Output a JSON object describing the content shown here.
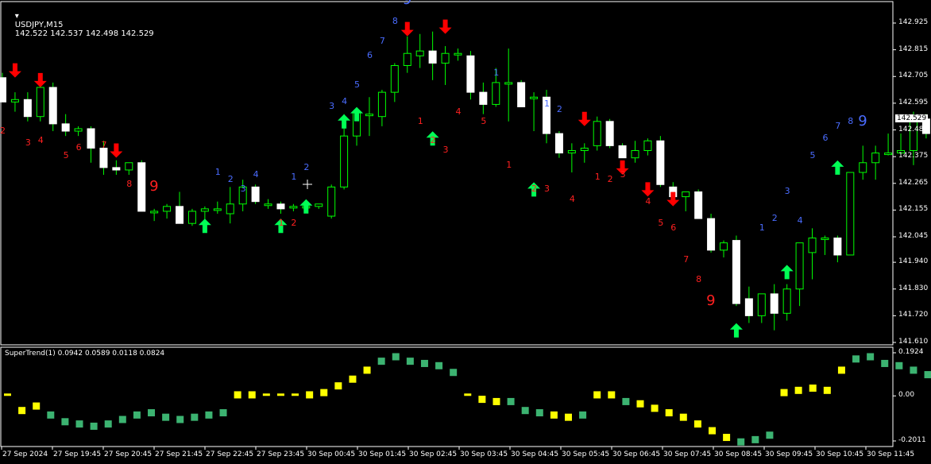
{
  "main": {
    "symbol_header": "USDJPY,M15",
    "ohlc": "142.522 142.537 142.498 142.529",
    "current_price": "142.529",
    "price_labels": [
      "142.925",
      "142.815",
      "142.705",
      "142.595",
      "142.485",
      "142.375",
      "142.265",
      "142.155",
      "142.045",
      "141.940",
      "141.830",
      "141.720",
      "141.610"
    ]
  },
  "indicator": {
    "header": "SuperTrend(1) 0.0942 0.0589 0.0118 0.0824",
    "scale_labels": [
      "0.1924",
      "0.00",
      "-0.2011"
    ]
  },
  "time_axis": [
    "27 Sep 2024",
    "27 Sep 19:45",
    "27 Sep 20:45",
    "27 Sep 21:45",
    "27 Sep 22:45",
    "27 Sep 23:45",
    "30 Sep 00:45",
    "30 Sep 01:45",
    "30 Sep 02:45",
    "30 Sep 03:45",
    "30 Sep 04:45",
    "30 Sep 05:45",
    "30 Sep 06:45",
    "30 Sep 07:45",
    "30 Sep 08:45",
    "30 Sep 09:45",
    "30 Sep 10:45",
    "30 Sep 11:45"
  ],
  "colors": {
    "bull": "#ffffff",
    "bear": "#ffffff",
    "wick": "#00ff00",
    "buy": "#00ff55",
    "sell": "#ff0000",
    "count_up": "#4a6cff",
    "count_down": "#ff2020",
    "hist_yellow": "#ffff00",
    "hist_green": "#3cb371",
    "grid": "#ffffff"
  },
  "candles": [
    [
      142.7,
      142.72,
      142.6,
      142.6
    ],
    [
      142.6,
      142.64,
      142.56,
      142.61
    ],
    [
      142.61,
      142.64,
      142.52,
      142.54
    ],
    [
      142.54,
      142.68,
      142.52,
      142.66
    ],
    [
      142.66,
      142.68,
      142.48,
      142.51
    ],
    [
      142.51,
      142.55,
      142.46,
      142.48
    ],
    [
      142.48,
      142.5,
      142.46,
      142.49
    ],
    [
      142.49,
      142.5,
      142.35,
      142.41
    ],
    [
      142.41,
      142.44,
      142.3,
      142.33
    ],
    [
      142.33,
      142.36,
      142.3,
      142.32
    ],
    [
      142.32,
      142.35,
      142.3,
      142.35
    ],
    [
      142.35,
      142.36,
      142.15,
      142.15
    ],
    [
      142.15,
      142.16,
      142.11,
      142.15
    ],
    [
      142.15,
      142.18,
      142.12,
      142.17
    ],
    [
      142.17,
      142.23,
      142.1,
      142.1
    ],
    [
      142.1,
      142.16,
      142.09,
      142.15
    ],
    [
      142.15,
      142.17,
      142.11,
      142.16
    ],
    [
      142.16,
      142.19,
      142.14,
      142.16
    ],
    [
      142.14,
      142.25,
      142.1,
      142.18
    ],
    [
      142.18,
      142.28,
      142.15,
      142.25
    ],
    [
      142.25,
      142.26,
      142.18,
      142.19
    ],
    [
      142.18,
      142.2,
      142.16,
      142.18
    ],
    [
      142.18,
      142.19,
      142.14,
      142.16
    ],
    [
      142.17,
      142.18,
      142.15,
      142.17
    ],
    [
      142.17,
      142.18,
      142.16,
      142.17
    ],
    [
      142.17,
      142.18,
      142.16,
      142.18
    ],
    [
      142.13,
      142.26,
      142.12,
      142.25
    ],
    [
      142.25,
      142.55,
      142.24,
      142.46
    ],
    [
      142.46,
      142.56,
      142.42,
      142.56
    ],
    [
      142.55,
      142.62,
      142.46,
      142.55
    ],
    [
      142.54,
      142.65,
      142.5,
      142.64
    ],
    [
      142.64,
      142.76,
      142.6,
      142.75
    ],
    [
      142.75,
      142.87,
      142.72,
      142.8
    ],
    [
      142.79,
      142.88,
      142.74,
      142.81
    ],
    [
      142.81,
      142.89,
      142.69,
      142.76
    ],
    [
      142.76,
      142.83,
      142.67,
      142.8
    ],
    [
      142.8,
      142.82,
      142.77,
      142.8
    ],
    [
      142.79,
      142.81,
      142.61,
      142.64
    ],
    [
      142.64,
      142.68,
      142.55,
      142.59
    ],
    [
      142.59,
      142.74,
      142.58,
      142.68
    ],
    [
      142.68,
      142.82,
      142.52,
      142.68
    ],
    [
      142.68,
      142.69,
      142.58,
      142.58
    ],
    [
      142.62,
      142.64,
      142.48,
      142.62
    ],
    [
      142.62,
      142.65,
      142.43,
      142.47
    ],
    [
      142.47,
      142.48,
      142.37,
      142.39
    ],
    [
      142.39,
      142.43,
      142.31,
      142.4
    ],
    [
      142.4,
      142.43,
      142.35,
      142.41
    ],
    [
      142.42,
      142.54,
      142.4,
      142.52
    ],
    [
      142.52,
      142.53,
      142.41,
      142.42
    ],
    [
      142.42,
      142.43,
      142.37,
      142.37
    ],
    [
      142.37,
      142.44,
      142.35,
      142.4
    ],
    [
      142.4,
      142.45,
      142.38,
      142.44
    ],
    [
      142.44,
      142.46,
      142.25,
      142.26
    ],
    [
      142.25,
      142.27,
      142.2,
      142.21
    ],
    [
      142.21,
      142.23,
      142.15,
      142.23
    ],
    [
      142.23,
      142.24,
      142.12,
      142.12
    ],
    [
      142.12,
      142.14,
      141.98,
      141.99
    ],
    [
      141.99,
      142.03,
      141.96,
      142.02
    ],
    [
      142.03,
      142.05,
      141.76,
      141.77
    ],
    [
      141.79,
      141.84,
      141.69,
      141.72
    ],
    [
      141.72,
      141.81,
      141.69,
      141.81
    ],
    [
      141.81,
      141.85,
      141.66,
      141.73
    ],
    [
      141.73,
      141.85,
      141.7,
      141.83
    ],
    [
      141.83,
      142.01,
      141.76,
      142.02
    ],
    [
      141.98,
      142.08,
      141.87,
      142.04
    ],
    [
      142.04,
      142.05,
      141.97,
      142.04
    ],
    [
      142.04,
      142.05,
      141.94,
      141.97
    ],
    [
      141.97,
      142.31,
      141.97,
      142.31
    ],
    [
      142.31,
      142.42,
      142.28,
      142.35
    ],
    [
      142.35,
      142.42,
      142.28,
      142.39
    ],
    [
      142.39,
      142.47,
      142.38,
      142.39
    ],
    [
      142.39,
      142.47,
      142.38,
      142.4
    ],
    [
      142.4,
      142.56,
      142.34,
      142.53
    ],
    [
      142.53,
      142.55,
      142.45,
      142.47
    ],
    [
      142.47,
      142.53,
      142.45,
      142.52
    ]
  ],
  "counts": [
    [
      "2",
      "down",
      0,
      142.48
    ],
    [
      "3",
      "down",
      2,
      142.43
    ],
    [
      "4",
      "down",
      3,
      142.44
    ],
    [
      "5",
      "down",
      5,
      142.38
    ],
    [
      "6",
      "down",
      6,
      142.41
    ],
    [
      "7",
      "down",
      8,
      142.42
    ],
    [
      "8",
      "down",
      10,
      142.26
    ],
    [
      "9",
      "down",
      12,
      142.25,
      true
    ],
    [
      "1",
      "up",
      17,
      142.31
    ],
    [
      "2",
      "up",
      18,
      142.28
    ],
    [
      "3",
      "up",
      19,
      142.24
    ],
    [
      "4",
      "up",
      20,
      142.3
    ],
    [
      "1",
      "down",
      22,
      142.1
    ],
    [
      "2",
      "down",
      23,
      142.1
    ],
    [
      "1",
      "up",
      23,
      142.29
    ],
    [
      "2",
      "up",
      24,
      142.33
    ],
    [
      "3",
      "up",
      26,
      142.58
    ],
    [
      "4",
      "up",
      27,
      142.6
    ],
    [
      "5",
      "up",
      28,
      142.67
    ],
    [
      "6",
      "up",
      29,
      142.79
    ],
    [
      "7",
      "up",
      30,
      142.85
    ],
    [
      "8",
      "up",
      31,
      142.93
    ],
    [
      "9",
      "up",
      32,
      143.02,
      true
    ],
    [
      "1",
      "down",
      33,
      142.52
    ],
    [
      "2",
      "down",
      34,
      142.44
    ],
    [
      "3",
      "down",
      35,
      142.4
    ],
    [
      "4",
      "down",
      36,
      142.56
    ],
    [
      "5",
      "down",
      38,
      142.52
    ],
    [
      "1",
      "up",
      39,
      142.72
    ],
    [
      "1",
      "down",
      40,
      142.34
    ],
    [
      "1",
      "up",
      43,
      142.59
    ],
    [
      "2",
      "up",
      44,
      142.57
    ],
    [
      "2",
      "down",
      42,
      142.24
    ],
    [
      "3",
      "down",
      43,
      142.24
    ],
    [
      "4",
      "down",
      45,
      142.2
    ],
    [
      "1",
      "down",
      47,
      142.29
    ],
    [
      "2",
      "down",
      48,
      142.28
    ],
    [
      "3",
      "down",
      49,
      142.3
    ],
    [
      "4",
      "down",
      51,
      142.19
    ],
    [
      "5",
      "down",
      52,
      142.1
    ],
    [
      "6",
      "down",
      53,
      142.08
    ],
    [
      "7",
      "down",
      54,
      141.95
    ],
    [
      "8",
      "down",
      55,
      141.87
    ],
    [
      "9",
      "down",
      56,
      141.78,
      true
    ],
    [
      "1",
      "up",
      60,
      142.08
    ],
    [
      "2",
      "up",
      61,
      142.12
    ],
    [
      "3",
      "up",
      62,
      142.23
    ],
    [
      "4",
      "up",
      63,
      142.11
    ],
    [
      "5",
      "up",
      64,
      142.38
    ],
    [
      "6",
      "up",
      65,
      142.45
    ],
    [
      "7",
      "up",
      66,
      142.5
    ],
    [
      "8",
      "up",
      67,
      142.52
    ],
    [
      "9",
      "up",
      68,
      142.52,
      true
    ]
  ],
  "arrows": [
    [
      "sell",
      1,
      142.73
    ],
    [
      "sell",
      3,
      142.69
    ],
    [
      "sell",
      9,
      142.4
    ],
    [
      "buy",
      16,
      142.09
    ],
    [
      "buy",
      22,
      142.09
    ],
    [
      "buy",
      24,
      142.17
    ],
    [
      "buy",
      27,
      142.52
    ],
    [
      "buy",
      28,
      142.55
    ],
    [
      "sell",
      32,
      142.9
    ],
    [
      "sell",
      35,
      142.91
    ],
    [
      "buy",
      34,
      142.45
    ],
    [
      "buy",
      42,
      142.24
    ],
    [
      "sell",
      46,
      142.53
    ],
    [
      "sell",
      49,
      142.33
    ],
    [
      "sell",
      51,
      142.24
    ],
    [
      "sell",
      53,
      142.2
    ],
    [
      "buy",
      58,
      141.66
    ],
    [
      "buy",
      62,
      141.9
    ],
    [
      "buy",
      66,
      142.33
    ]
  ],
  "histogram": [
    [
      0.0,
      "y"
    ],
    [
      -0.06,
      "y"
    ],
    [
      -0.04,
      "y"
    ],
    [
      -0.08,
      "g"
    ],
    [
      -0.11,
      "g"
    ],
    [
      -0.12,
      "g"
    ],
    [
      -0.13,
      "g"
    ],
    [
      -0.12,
      "g"
    ],
    [
      -0.1,
      "g"
    ],
    [
      -0.08,
      "g"
    ],
    [
      -0.07,
      "g"
    ],
    [
      -0.09,
      "g"
    ],
    [
      -0.1,
      "g"
    ],
    [
      -0.09,
      "g"
    ],
    [
      -0.08,
      "g"
    ],
    [
      -0.07,
      "g"
    ],
    [
      0.01,
      "y"
    ],
    [
      0.01,
      "y"
    ],
    [
      0.0,
      "y"
    ],
    [
      0.0,
      "y"
    ],
    [
      0.0,
      "y"
    ],
    [
      0.01,
      "y"
    ],
    [
      0.02,
      "y"
    ],
    [
      0.05,
      "y"
    ],
    [
      0.08,
      "y"
    ],
    [
      0.12,
      "y"
    ],
    [
      0.16,
      "g"
    ],
    [
      0.18,
      "g"
    ],
    [
      0.16,
      "g"
    ],
    [
      0.15,
      "g"
    ],
    [
      0.14,
      "g"
    ],
    [
      0.11,
      "g"
    ],
    [
      0.0,
      "y"
    ],
    [
      -0.01,
      "y"
    ],
    [
      -0.02,
      "y"
    ],
    [
      -0.02,
      "g"
    ],
    [
      -0.06,
      "g"
    ],
    [
      -0.07,
      "g"
    ],
    [
      -0.08,
      "y"
    ],
    [
      -0.09,
      "y"
    ],
    [
      -0.08,
      "g"
    ],
    [
      0.01,
      "y"
    ],
    [
      0.01,
      "y"
    ],
    [
      -0.02,
      "g"
    ],
    [
      -0.03,
      "y"
    ],
    [
      -0.05,
      "y"
    ],
    [
      -0.07,
      "y"
    ],
    [
      -0.09,
      "y"
    ],
    [
      -0.12,
      "y"
    ],
    [
      -0.15,
      "y"
    ],
    [
      -0.18,
      "y"
    ],
    [
      -0.2,
      "g"
    ],
    [
      -0.19,
      "g"
    ],
    [
      -0.17,
      "g"
    ],
    [
      0.02,
      "y"
    ],
    [
      0.03,
      "y"
    ],
    [
      0.04,
      "y"
    ],
    [
      0.03,
      "y"
    ],
    [
      0.12,
      "y"
    ],
    [
      0.17,
      "g"
    ],
    [
      0.18,
      "g"
    ],
    [
      0.15,
      "g"
    ],
    [
      0.14,
      "g"
    ],
    [
      0.12,
      "g"
    ],
    [
      0.1,
      "g"
    ],
    [
      0.08,
      "g"
    ]
  ]
}
